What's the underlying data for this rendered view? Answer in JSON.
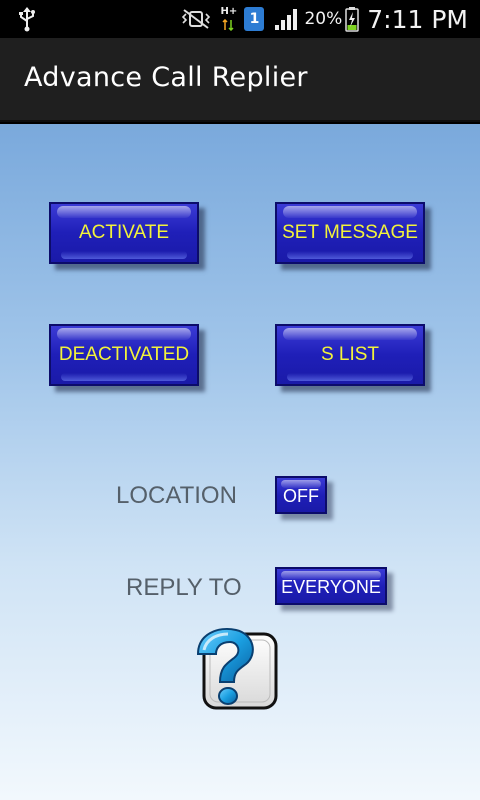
{
  "statusbar": {
    "usb_icon": "usb-icon",
    "mute_icon": "vibrate-mute-icon",
    "network": "H+",
    "sim": "1",
    "battery_percent": "20%",
    "time": "7:11 PM"
  },
  "app": {
    "title": "Advance Call Replier"
  },
  "buttons": {
    "activate": "ACTIVATE",
    "set_message": "SET MESSAGE",
    "deactivated": "DEACTIVATED",
    "s_list": "S LIST"
  },
  "settings": {
    "location_label": "LOCATION",
    "location_value": "OFF",
    "reply_to_label": "REPLY TO",
    "reply_to_value": "EVERYONE"
  },
  "colors": {
    "button_fill": "#1f1fb8",
    "button_text": "#f3f33a",
    "title_bar": "#1f1f1f",
    "background_top": "#7aa9dc",
    "background_bottom": "#f2f8fd",
    "label_text": "#55606a"
  },
  "icons": {
    "help": "help-question-icon"
  }
}
